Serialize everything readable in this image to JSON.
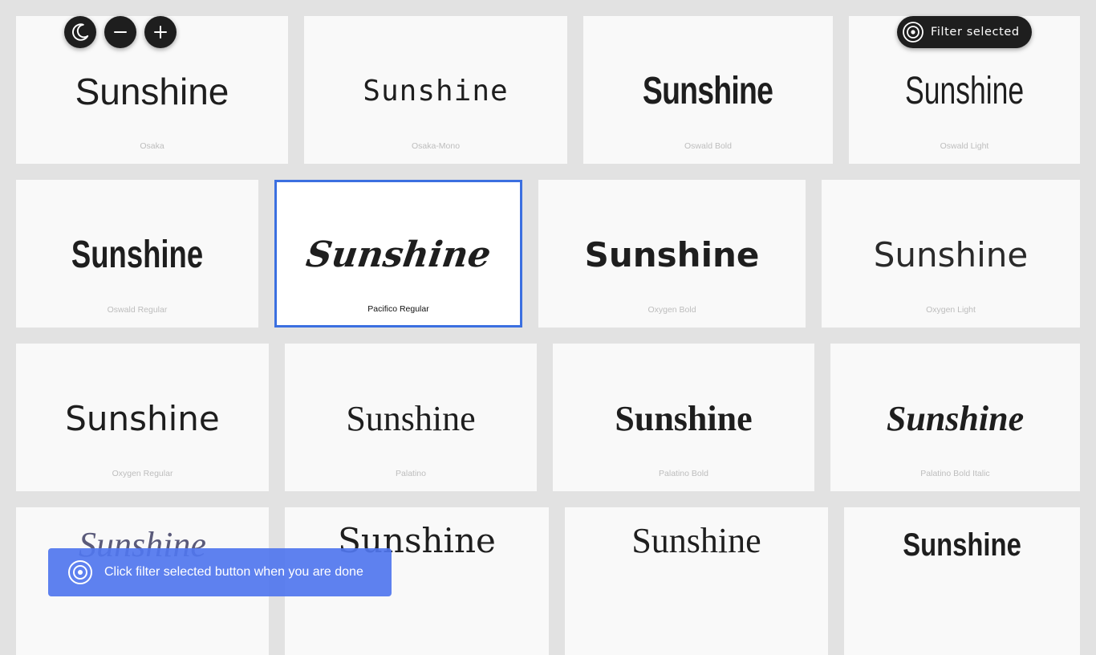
{
  "controls": {
    "theme_icon": "moon-icon",
    "zoom_out_icon": "minus-icon",
    "zoom_in_icon": "plus-icon",
    "filter_icon": "target-icon",
    "filter_label": "Filter selected"
  },
  "fonts": [
    {
      "sample": "Sunshine",
      "name": "Osaka"
    },
    {
      "sample": "Sunshine",
      "name": "Osaka-Mono"
    },
    {
      "sample": "Sunshine",
      "name": "Oswald Bold"
    },
    {
      "sample": "Sunshine",
      "name": "Oswald Light"
    },
    {
      "sample": "Sunshine",
      "name": "Oswald Regular"
    },
    {
      "sample": "Sunshine",
      "name": "Pacifico Regular",
      "selected": true
    },
    {
      "sample": "Sunshine",
      "name": "Oxygen Bold"
    },
    {
      "sample": "Sunshine",
      "name": "Oxygen Light"
    },
    {
      "sample": "Sunshine",
      "name": "Oxygen Regular"
    },
    {
      "sample": "Sunshine",
      "name": "Palatino"
    },
    {
      "sample": "Sunshine",
      "name": "Palatino Bold"
    },
    {
      "sample": "Sunshine",
      "name": "Palatino Bold Italic"
    },
    {
      "sample": "Sunshine",
      "name": ""
    },
    {
      "sample": "Sunshine",
      "name": ""
    },
    {
      "sample": "Sunshine",
      "name": ""
    },
    {
      "sample": "Sunshine",
      "name": ""
    }
  ],
  "toast": {
    "icon": "target-icon",
    "message": "Click filter selected button when you are done"
  },
  "colors": {
    "accent": "#3b6fe0",
    "toast": "#5076ee",
    "button": "#1e1e1e",
    "background": "#e2e2e2"
  }
}
